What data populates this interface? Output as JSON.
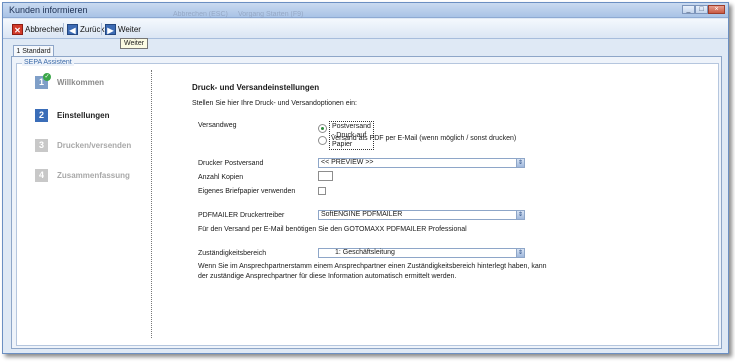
{
  "window": {
    "title": "Kunden informieren",
    "ghost_items": [
      "Abbrechen (ESC)",
      "Vorgang Starten (F9)"
    ],
    "controls": [
      "_",
      "□",
      "×"
    ]
  },
  "toolbar": {
    "cancel_label": "Abbrechen",
    "back_label": "Zurück",
    "next_label": "Weiter",
    "tooltip": "Weiter"
  },
  "tab": {
    "label": "1 Standard"
  },
  "group": {
    "legend": "SEPA Assistent"
  },
  "steps": [
    {
      "number": "1",
      "label": "Willkommen",
      "state": "done"
    },
    {
      "number": "2",
      "label": "Einstellungen",
      "state": "active"
    },
    {
      "number": "3",
      "label": "Drucken/versenden",
      "state": "inactive"
    },
    {
      "number": "4",
      "label": "Zusammenfassung",
      "state": "inactive"
    }
  ],
  "form": {
    "heading": "Druck- und Versandeinstellungen",
    "intro": "Stellen Sie hier Ihre Druck- und Versandoptionen ein:",
    "versandweg_label": "Versandweg",
    "option_post": "Postversand - Druck auf Papier",
    "option_pdf": "Versand als PDF per E-Mail (wenn möglich / sonst drucken)",
    "drucker_label": "Drucker Postversand",
    "drucker_value": "<< PREVIEW >>",
    "kopien_label": "Anzahl Kopien",
    "kopien_value": "",
    "briefpapier_label": "Eigenes Briefpapier verwenden",
    "pdfmailer_label": "PDFMAILER Druckertreiber",
    "pdfmailer_value": "SoftENGINE PDFMAILER",
    "pdfmailer_note": "Für den Versand per E-Mail benötigen Sie den GOTOMAXX PDFMAILER Professional",
    "zustaendigkeit_label": "Zuständigkeitsbereich",
    "zustaendigkeit_value": "1: Geschäftsleitung",
    "note_line1": "Wenn Sie im Ansprechpartnerstamm einem Ansprechpartner einen Zuständigkeitsbereich hinterlegt haben, kann",
    "note_line2": "der zuständige Ansprechpartner für diese Information automatisch ermittelt werden."
  },
  "icons": {
    "cancel": "close-icon",
    "back": "arrow-left-icon",
    "next": "arrow-right-icon",
    "combo": "spinner-arrows-icon",
    "check": "checkmark-icon"
  },
  "colors": {
    "accent": "#3a6db8",
    "done_check": "#3aa648",
    "cancel_red": "#d23a2a"
  }
}
